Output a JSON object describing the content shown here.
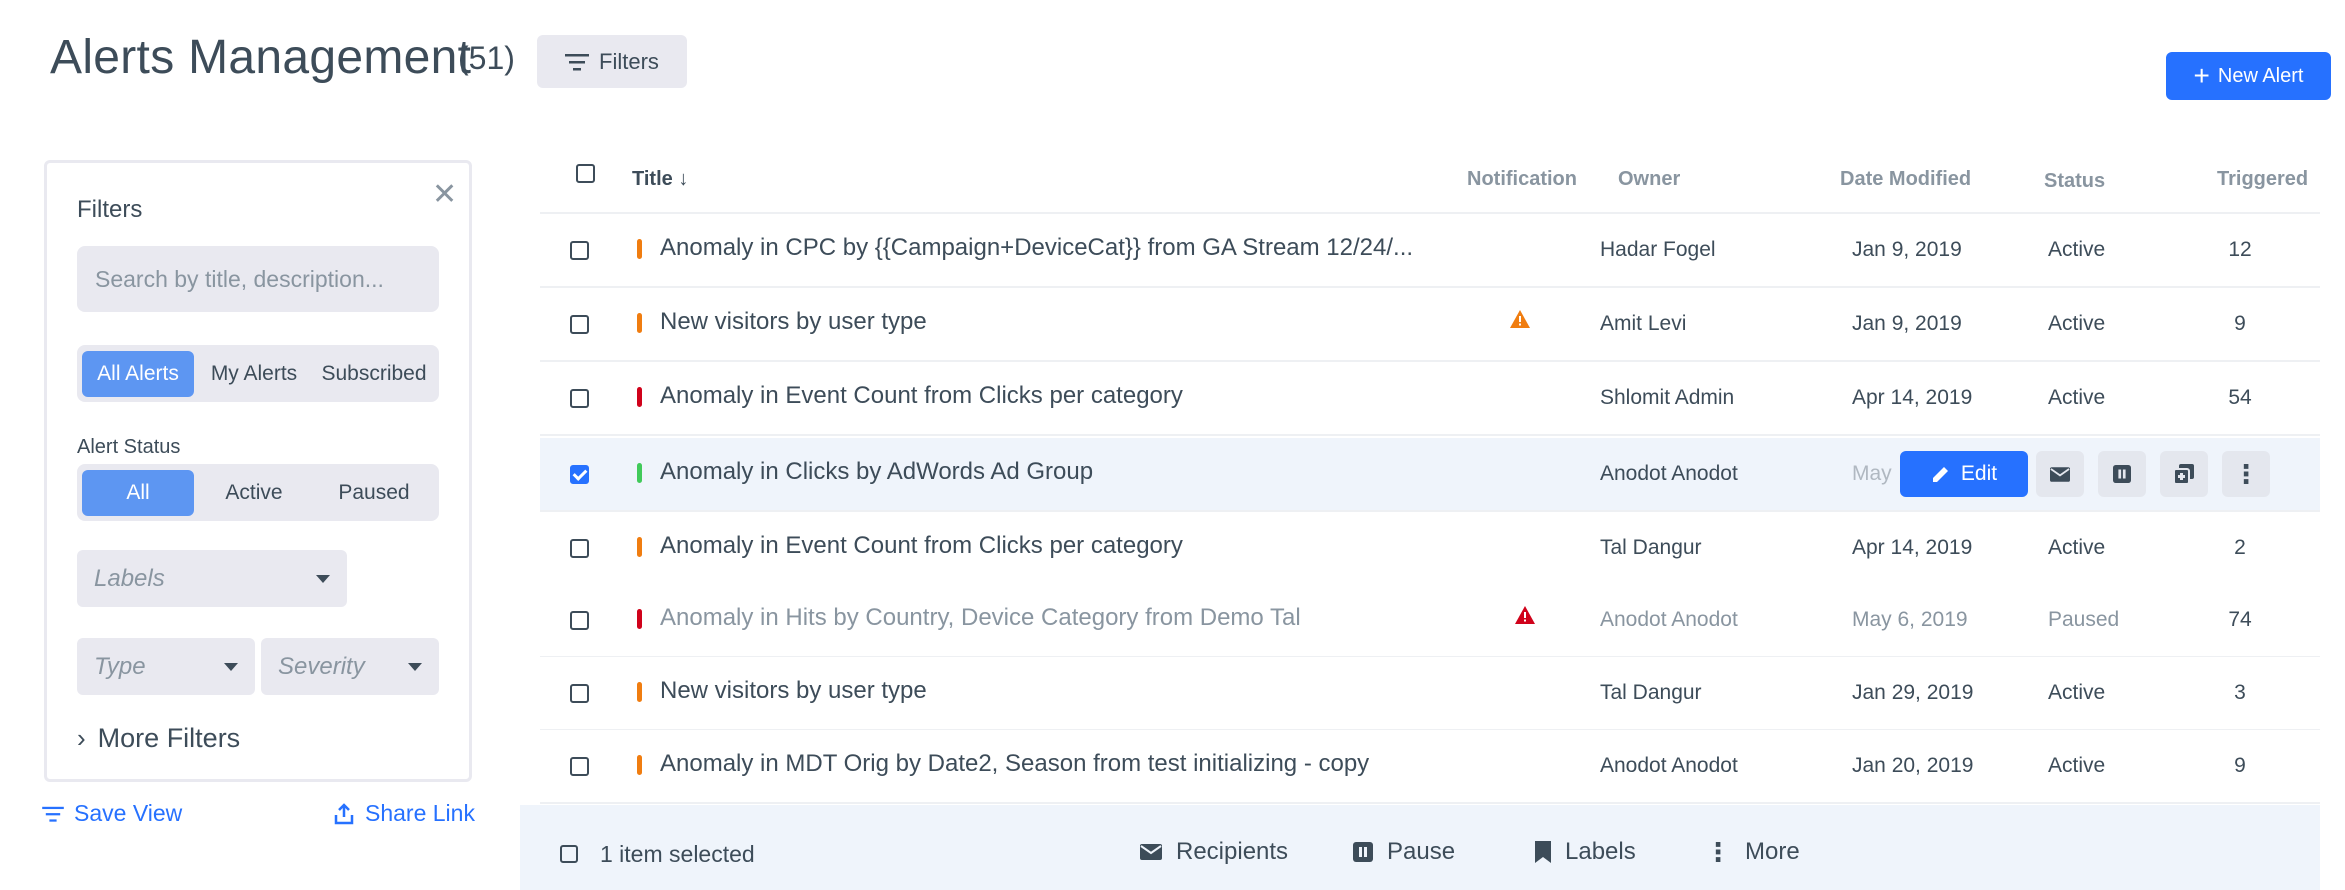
{
  "header": {
    "title": "Alerts Management",
    "count": "(51)",
    "filters_label": "Filters",
    "new_alert_label": "New Alert"
  },
  "filter_panel": {
    "title": "Filters",
    "search_placeholder": "Search by title, description...",
    "scope_options": [
      "All Alerts",
      "My Alerts",
      "Subscribed"
    ],
    "scope_selected": "All Alerts",
    "status_label": "Alert Status",
    "status_options": [
      "All",
      "Active",
      "Paused"
    ],
    "status_selected": "All",
    "labels_placeholder": "Labels",
    "type_placeholder": "Type",
    "severity_placeholder": "Severity",
    "more_filters_label": "More Filters"
  },
  "panel_links": {
    "save_view": "Save View",
    "share_link": "Share Link"
  },
  "table": {
    "columns": [
      "Title",
      "Notification",
      "Owner",
      "Date Modified",
      "Status",
      "Triggered"
    ],
    "rows": [
      {
        "title": "Anomaly in CPC by {{Campaign+DeviceCat}} from GA Stream 12/24/...",
        "severity_color": "#f07d10",
        "notification": "",
        "owner": "Hadar Fogel",
        "date": "Jan 9, 2019",
        "status": "Active",
        "triggered": "12",
        "checked": false
      },
      {
        "title": "New visitors by user type",
        "severity_color": "#f07d10",
        "notification": "warning",
        "owner": "Amit Levi",
        "date": "Jan 9, 2019",
        "status": "Active",
        "triggered": "9",
        "checked": false
      },
      {
        "title": "Anomaly in Event Count from Clicks per category",
        "severity_color": "#d0021b",
        "notification": "",
        "owner": "Shlomit Admin",
        "date": "Apr 14, 2019",
        "status": "Active",
        "triggered": "54",
        "checked": false
      },
      {
        "title": "Anomaly in Clicks by AdWords Ad Group",
        "severity_color": "#41ca5a",
        "notification": "",
        "owner": "Anodot Anodot",
        "date": "May",
        "status": "",
        "triggered": "",
        "checked": true
      },
      {
        "title": "Anomaly in Event Count from Clicks per category",
        "severity_color": "#f07d10",
        "notification": "",
        "owner": "Tal Dangur",
        "date": "Apr 14, 2019",
        "status": "Active",
        "triggered": "2",
        "checked": false
      },
      {
        "title": "Anomaly in Hits by Country, Device Category from Demo Tal",
        "severity_color": "#d0021b",
        "notification": "error",
        "owner": "Anodot Anodot",
        "date": "May 6, 2019",
        "status": "Paused",
        "triggered": "74",
        "checked": false
      },
      {
        "title": "New visitors by user type",
        "severity_color": "#f07d10",
        "notification": "",
        "owner": "Tal Dangur",
        "date": "Jan 29, 2019",
        "status": "Active",
        "triggered": "3",
        "checked": false
      },
      {
        "title": "Anomaly in MDT Orig by Date2, Season from test initializing - copy",
        "severity_color": "#f07d10",
        "notification": "",
        "owner": "Anodot Anodot",
        "date": "Jan 20, 2019",
        "status": "Active",
        "triggered": "9",
        "checked": false
      }
    ],
    "row_actions": {
      "edit_label": "Edit"
    }
  },
  "action_bar": {
    "selected_text": "1 item selected",
    "recipients_label": "Recipients",
    "pause_label": "Pause",
    "labels_label": "Labels",
    "more_label": "More"
  },
  "colors": {
    "accent": "#2671ff",
    "selected_pill": "#5d96f2",
    "warning": "#f07d10",
    "error": "#d0021b",
    "ok": "#41ca5a"
  }
}
